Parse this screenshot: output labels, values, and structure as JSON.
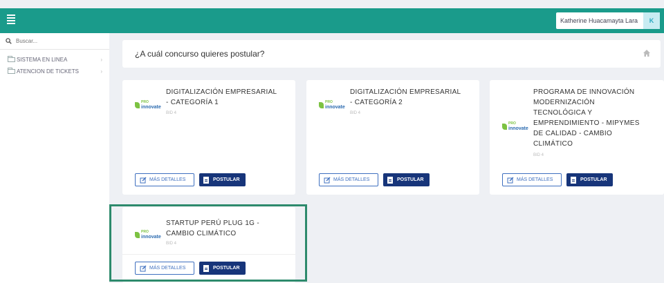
{
  "topbar": {
    "user_name": "Katherine Huacamayta Lara",
    "user_initial": "K"
  },
  "sidebar": {
    "search_placeholder": "Buscar...",
    "items": [
      {
        "label": "SISTEMA EN LINEA"
      },
      {
        "label": "ATENCION DE TICKETS"
      }
    ]
  },
  "header": {
    "title": "¿A cuál concurso quieres postular?"
  },
  "cards": [
    {
      "title_lines": [
        "DIGITALIZACIÓN EMPRESARIAL",
        "- CATEGORÍA 1"
      ],
      "sub": "BID 4",
      "logo_top": "PRO",
      "logo_bottom": "innovate"
    },
    {
      "title_lines": [
        "DIGITALIZACIÓN EMPRESARIAL",
        "- CATEGORÍA 2"
      ],
      "sub": "BID 4",
      "logo_top": "PRO",
      "logo_bottom": "innovate"
    },
    {
      "title_lines": [
        "PROGRAMA DE INNOVACIÓN",
        "MODERNIZACIÓN",
        "TECNOLÓGICA Y",
        "EMPRENDIMIENTO - MIPYMES",
        "DE CALIDAD - CAMBIO",
        "CLIMÁTICO"
      ],
      "sub": "BID 4",
      "logo_top": "PRO",
      "logo_bottom": "innovate"
    },
    {
      "title_lines": [
        "STARTUP PERÚ PLUG 1G -",
        "CAMBIO CLIMÁTICO"
      ],
      "sub": "BID 4",
      "logo_top": "PRO",
      "logo_bottom": "innovate"
    }
  ],
  "buttons": {
    "details_label": "MÁS DETALLES",
    "apply_label": "POSTULAR"
  },
  "colors": {
    "topbar": "#1a9b8b",
    "apply_button": "#17357a",
    "details_border": "#3e6fbf",
    "highlight": "#2d8a6c"
  }
}
